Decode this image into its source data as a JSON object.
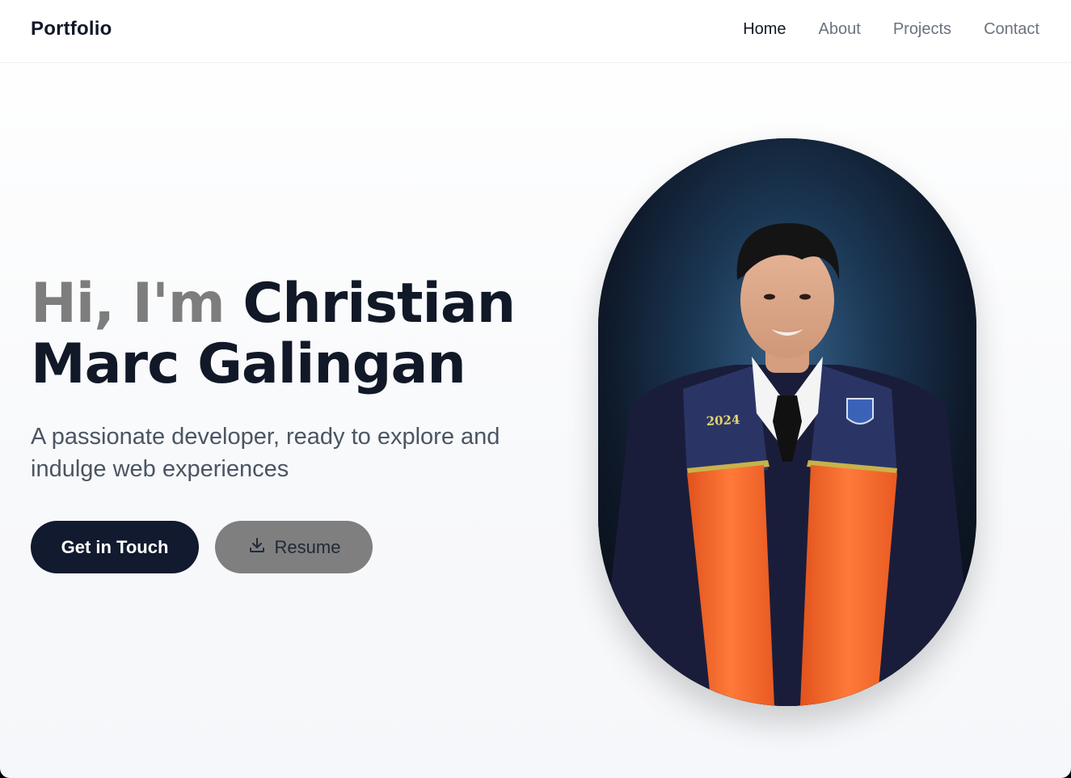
{
  "header": {
    "brand": "Portfolio",
    "nav": [
      {
        "label": "Home",
        "active": true
      },
      {
        "label": "About",
        "active": false
      },
      {
        "label": "Projects",
        "active": false
      },
      {
        "label": "Contact",
        "active": false
      }
    ]
  },
  "hero": {
    "greeting": "Hi, I'm",
    "name_line1": "Christian",
    "name_line2": "Marc Galingan",
    "subtitle": "A passionate developer, ready to explore and indulge web experiences",
    "primary_button": "Get in Touch",
    "secondary_button": "Resume",
    "secondary_icon": "download-icon",
    "portrait": {
      "subject": "graduation-portrait",
      "year_embroidery": "2024"
    }
  },
  "colors": {
    "primary": "#111a2e",
    "muted_button": "#7f7f7f",
    "greeting_gray": "#7d7d7d",
    "stole_orange": "#f2692a",
    "gown_navy": "#1c1f3d"
  }
}
